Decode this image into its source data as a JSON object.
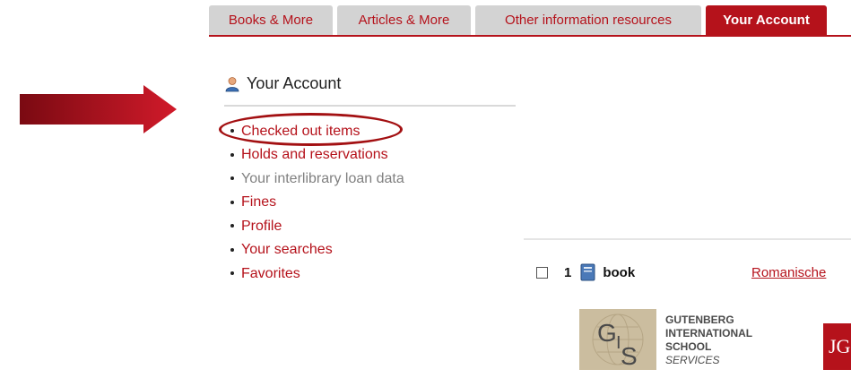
{
  "tabs": [
    {
      "label": "Books & More",
      "active": false
    },
    {
      "label": "Articles & More",
      "active": false
    },
    {
      "label": "Other information resources",
      "active": false
    },
    {
      "label": "Your Account",
      "active": true
    }
  ],
  "account": {
    "title": "Your Account",
    "icon": "user-icon",
    "menu": [
      {
        "label": "Checked out items",
        "enabled": true
      },
      {
        "label": "Holds and reservations",
        "enabled": true
      },
      {
        "label": "Your interlibrary loan data",
        "enabled": false
      },
      {
        "label": "Fines",
        "enabled": true
      },
      {
        "label": "Profile",
        "enabled": true
      },
      {
        "label": "Your searches",
        "enabled": true
      },
      {
        "label": "Favorites",
        "enabled": true
      }
    ]
  },
  "result": {
    "number": "1",
    "media_type": "book",
    "title": "Romanische"
  },
  "logos": {
    "gis": {
      "initials": "GIS",
      "lines": [
        "GUTENBERG",
        "INTERNATIONAL",
        "SCHOOL",
        "SERVICES"
      ]
    },
    "jgu": {
      "text": "JG|U"
    }
  },
  "colors": {
    "accent": "#b5121b",
    "tab_inactive": "#d3d3d3",
    "annotation": "#a31012"
  }
}
